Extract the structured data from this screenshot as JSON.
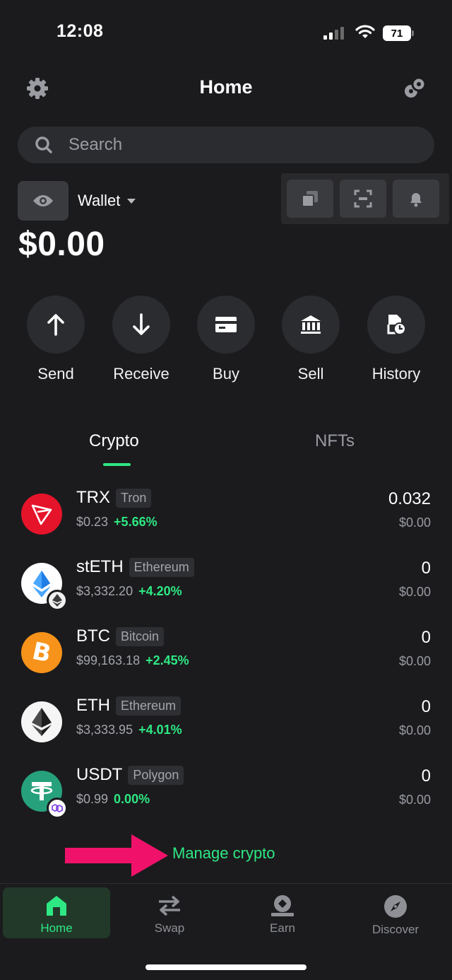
{
  "status": {
    "time": "12:08",
    "battery": "71"
  },
  "header": {
    "title": "Home"
  },
  "search": {
    "placeholder": "Search"
  },
  "wallet": {
    "label": "Wallet",
    "balance": "$0.00"
  },
  "actions": [
    {
      "label": "Send",
      "icon": "arrow-up-icon"
    },
    {
      "label": "Receive",
      "icon": "arrow-down-icon"
    },
    {
      "label": "Buy",
      "icon": "card-icon"
    },
    {
      "label": "Sell",
      "icon": "bank-icon"
    },
    {
      "label": "History",
      "icon": "history-icon"
    }
  ],
  "tabs": [
    {
      "label": "Crypto",
      "active": true
    },
    {
      "label": "NFTs",
      "active": false
    }
  ],
  "assets": [
    {
      "symbol": "TRX",
      "network": "Tron",
      "price": "$0.23",
      "change": "+5.66%",
      "amount": "0.032",
      "value": "$0.00",
      "color": "#e5142a"
    },
    {
      "symbol": "stETH",
      "network": "Ethereum",
      "price": "$3,332.20",
      "change": "+4.20%",
      "amount": "0",
      "value": "$0.00",
      "color": "#ffffff"
    },
    {
      "symbol": "BTC",
      "network": "Bitcoin",
      "price": "$99,163.18",
      "change": "+2.45%",
      "amount": "0",
      "value": "$0.00",
      "color": "#f7931a"
    },
    {
      "symbol": "ETH",
      "network": "Ethereum",
      "price": "$3,333.95",
      "change": "+4.01%",
      "amount": "0",
      "value": "$0.00",
      "color": "#f5f5f5"
    },
    {
      "symbol": "USDT",
      "network": "Polygon",
      "price": "$0.99",
      "change": "0.00%",
      "amount": "0",
      "value": "$0.00",
      "color": "#26a17b"
    }
  ],
  "manage": {
    "label": "Manage crypto"
  },
  "nav": [
    {
      "label": "Home",
      "icon": "home-icon",
      "active": true
    },
    {
      "label": "Swap",
      "icon": "swap-icon",
      "active": false
    },
    {
      "label": "Earn",
      "icon": "earn-icon",
      "active": false
    },
    {
      "label": "Discover",
      "icon": "compass-icon",
      "active": false
    }
  ],
  "colors": {
    "accent": "#2ee883",
    "background": "#1b1b1d",
    "annotation_arrow": "#f0126a"
  }
}
